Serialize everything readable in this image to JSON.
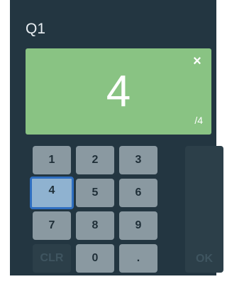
{
  "question": {
    "label": "Q1"
  },
  "score": {
    "value": "4",
    "max": "/4",
    "close_icon": "×"
  },
  "keypad": {
    "keys": [
      "1",
      "2",
      "3",
      "4",
      "5",
      "6",
      "7",
      "8",
      "9",
      "CLR",
      "0",
      "."
    ],
    "selected": "4",
    "ok_label": "OK"
  },
  "colors": {
    "panel_bg": "#233641",
    "score_bg": "#89c383",
    "key_bg": "#8a99a1",
    "selected_border": "#2f6fc1"
  }
}
